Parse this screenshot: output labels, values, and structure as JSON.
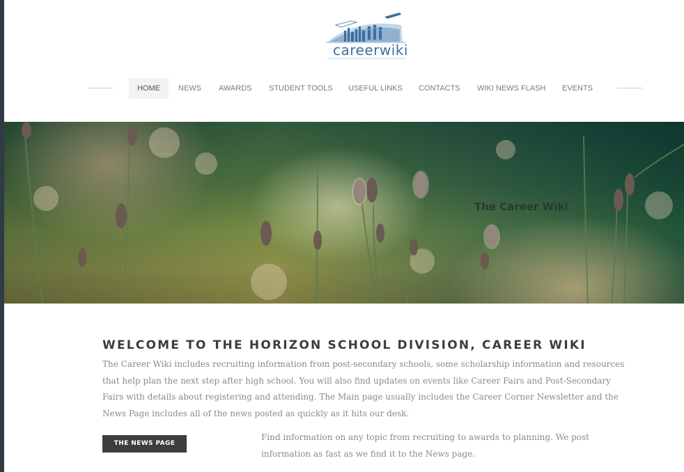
{
  "header": {
    "logo_text": "careerwiki"
  },
  "nav": {
    "items": [
      {
        "label": "HOME",
        "active": true
      },
      {
        "label": "NEWS",
        "active": false
      },
      {
        "label": "AWARDS",
        "active": false
      },
      {
        "label": "STUDENT TOOLS",
        "active": false
      },
      {
        "label": "USEFUL LINKS",
        "active": false
      },
      {
        "label": "CONTACTS",
        "active": false
      },
      {
        "label": "WIKI NEWS FLASH",
        "active": false
      },
      {
        "label": "EVENTS",
        "active": false
      }
    ]
  },
  "hero": {
    "title": "The Career Wiki"
  },
  "welcome": {
    "heading": "WELCOME TO THE HORIZON SCHOOL DIVISION, CAREER WIKI",
    "body": "The Career Wiki includes recruiting information from post-secondary schools, some scholarship information and resources that help plan the next step after high school. You will also find updates on events like Career Fairs and Post-Secondary Fairs with details about registering and attending.  The Main page usually includes the Career Corner Newsletter and the News Page includes all of the news posted as quickly as it hits our desk."
  },
  "news_section": {
    "button_label": "THE NEWS PAGE",
    "description": "Find information on any topic from recruiting to awards to planning.  We post information as fast as we find it to the News page."
  },
  "colors": {
    "frame": "#2f3b45",
    "button_bg": "#3e3e3e",
    "logo_blue": "#3d6fa0",
    "nav_active_bg": "#f2f2f2"
  }
}
